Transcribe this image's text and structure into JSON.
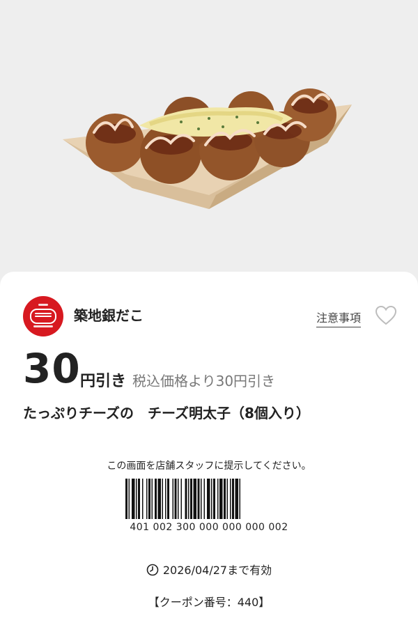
{
  "product_image": {
    "alt_name": "takoyaki-product-image"
  },
  "shop": {
    "name": "築地銀だこ",
    "logo_icon": "gindaco-logo-icon",
    "brand_color": "#d71920"
  },
  "header_links": {
    "notes": "注意事項",
    "favorite_icon": "heart-outline-icon"
  },
  "discount": {
    "amount": "30",
    "unit": "円引き",
    "note": "税込価格より30円引き"
  },
  "product_title": "たっぷりチーズの　チーズ明太子（8個入り）",
  "instruction": "この画面を店舗スタッフに提示してください。",
  "barcode_number": "401 002 300 000 000 000 002",
  "expiry": {
    "icon": "clock-icon",
    "text": "2026/04/27まで有効"
  },
  "coupon_number": "【クーポン番号：440】"
}
